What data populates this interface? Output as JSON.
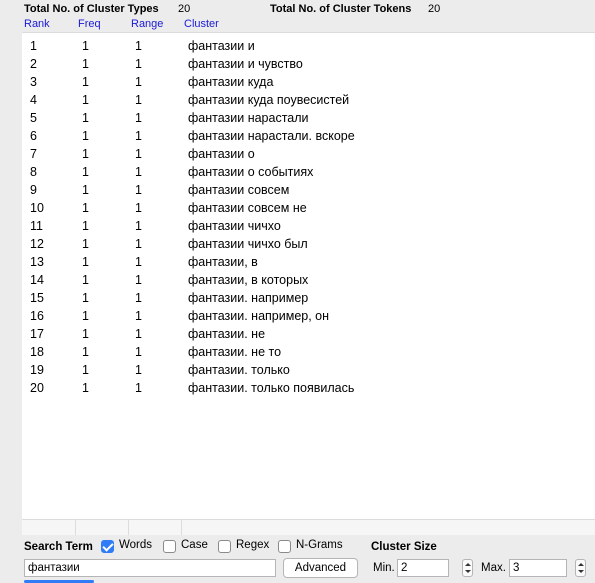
{
  "summary": {
    "types_label": "Total No. of Cluster Types",
    "types_value": "20",
    "tokens_label": "Total No. of Cluster Tokens",
    "tokens_value": "20"
  },
  "table": {
    "headers": [
      "Rank",
      "Freq",
      "Range",
      "Cluster"
    ],
    "rows": [
      [
        "1",
        "1",
        "1",
        "фантазии и"
      ],
      [
        "2",
        "1",
        "1",
        "фантазии и чувство"
      ],
      [
        "3",
        "1",
        "1",
        "фантазии куда"
      ],
      [
        "4",
        "1",
        "1",
        "фантазии куда поувесистей"
      ],
      [
        "5",
        "1",
        "1",
        "фантазии нарастали"
      ],
      [
        "6",
        "1",
        "1",
        "фантазии нарастали. вскоре"
      ],
      [
        "7",
        "1",
        "1",
        "фантазии о"
      ],
      [
        "8",
        "1",
        "1",
        "фантазии о событиях"
      ],
      [
        "9",
        "1",
        "1",
        "фантазии совсем"
      ],
      [
        "10",
        "1",
        "1",
        "фантазии совсем не"
      ],
      [
        "11",
        "1",
        "1",
        "фантазии чичхо"
      ],
      [
        "12",
        "1",
        "1",
        "фантазии чичхо был"
      ],
      [
        "13",
        "1",
        "1",
        "фантазии, в"
      ],
      [
        "14",
        "1",
        "1",
        "фантазии, в которых"
      ],
      [
        "15",
        "1",
        "1",
        "фантазии. например"
      ],
      [
        "16",
        "1",
        "1",
        "фантазии. например, он"
      ],
      [
        "17",
        "1",
        "1",
        "фантазии. не"
      ],
      [
        "18",
        "1",
        "1",
        "фантазии. не то"
      ],
      [
        "19",
        "1",
        "1",
        "фантазии. только"
      ],
      [
        "20",
        "1",
        "1",
        "фантазии. только появилась"
      ]
    ]
  },
  "search": {
    "term_label": "Search Term",
    "options": [
      {
        "label": "Words",
        "checked": true
      },
      {
        "label": "Case",
        "checked": false
      },
      {
        "label": "Regex",
        "checked": false
      },
      {
        "label": "N-Grams",
        "checked": false
      }
    ],
    "term_value": "фантазии",
    "advanced_label": "Advanced",
    "cluster_size_label": "Cluster Size",
    "min_label": "Min.",
    "min_value": "2",
    "max_label": "Max.",
    "max_value": "3"
  }
}
